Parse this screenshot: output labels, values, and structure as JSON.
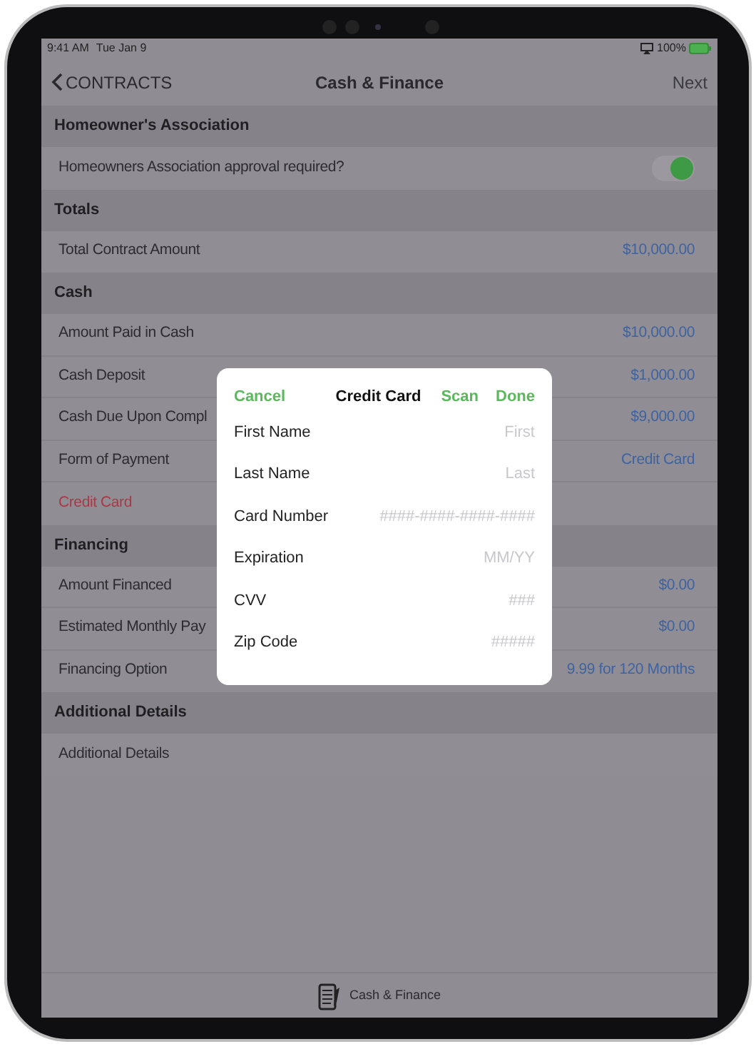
{
  "status_bar": {
    "time": "9:41 AM",
    "date": "Tue Jan 9",
    "battery": "100%"
  },
  "nav": {
    "back": "CONTRACTS",
    "title": "Cash & Finance",
    "next": "Next"
  },
  "sections": [
    {
      "header": "Homeowner's Association",
      "rows": [
        {
          "kind": "toggle",
          "label": "Homeowners Association approval required?",
          "on": true
        }
      ]
    },
    {
      "header": "Totals",
      "rows": [
        {
          "kind": "value",
          "label": "Total Contract Amount",
          "value": "$10,000.00"
        }
      ]
    },
    {
      "header": "Cash",
      "rows": [
        {
          "kind": "value",
          "label": "Amount Paid in Cash",
          "value": "$10,000.00"
        },
        {
          "kind": "value",
          "label": "Cash Deposit",
          "value": "$1,000.00"
        },
        {
          "kind": "value",
          "label": "Cash Due Upon Compl",
          "value": "$9,000.00"
        },
        {
          "kind": "value",
          "label": "Form of Payment",
          "value": "Credit Card"
        },
        {
          "kind": "action",
          "label": "Credit Card"
        }
      ]
    },
    {
      "header": "Financing",
      "rows": [
        {
          "kind": "value",
          "label": "Amount Financed",
          "value": "$0.00"
        },
        {
          "kind": "value",
          "label": "Estimated Monthly Pay",
          "value": "$0.00"
        },
        {
          "kind": "value",
          "label": "Financing Option",
          "value": "9.99 for 120 Months"
        }
      ]
    },
    {
      "header": "Additional Details",
      "rows": [
        {
          "kind": "plain",
          "label": "Additional Details"
        }
      ]
    }
  ],
  "dialog": {
    "cancel": "Cancel",
    "title": "Credit Card",
    "scan": "Scan",
    "done": "Done",
    "fields": [
      {
        "label": "First Name",
        "placeholder": "First"
      },
      {
        "label": "Last Name",
        "placeholder": "Last"
      },
      {
        "label": "Card Number",
        "placeholder": "####-####-####-####"
      },
      {
        "label": "Expiration",
        "placeholder": "MM/YY"
      },
      {
        "label": "CVV",
        "placeholder": "###"
      },
      {
        "label": "Zip Code",
        "placeholder": "#####"
      }
    ]
  },
  "tab_bar": {
    "label": "Cash & Finance"
  }
}
